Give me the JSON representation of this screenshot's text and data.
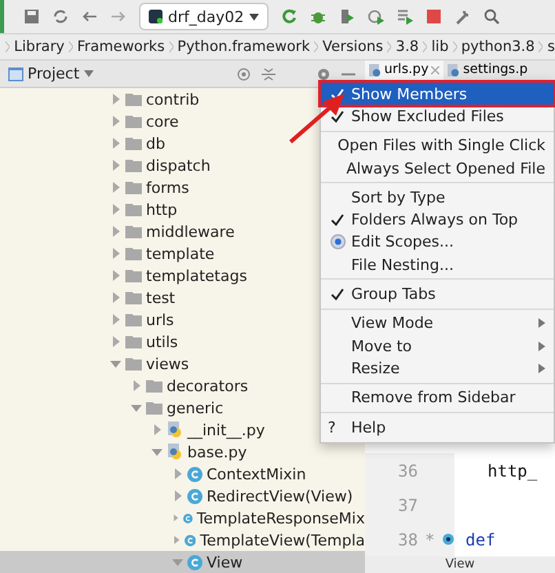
{
  "toolbar": {
    "run_config": "drf_day02"
  },
  "breadcrumbs": [
    "Library",
    "Frameworks",
    "Python.framework",
    "Versions",
    "3.8",
    "lib",
    "python3.8",
    "s"
  ],
  "project_panel": {
    "title": "Project",
    "tree": [
      {
        "label": "contrib",
        "kind": "folder",
        "expanded": false,
        "selected": false
      },
      {
        "label": "core",
        "kind": "folder",
        "expanded": false,
        "selected": false
      },
      {
        "label": "db",
        "kind": "folder",
        "expanded": false,
        "selected": false
      },
      {
        "label": "dispatch",
        "kind": "folder",
        "expanded": false,
        "selected": false
      },
      {
        "label": "forms",
        "kind": "folder",
        "expanded": false,
        "selected": false
      },
      {
        "label": "http",
        "kind": "folder",
        "expanded": false,
        "selected": false
      },
      {
        "label": "middleware",
        "kind": "folder",
        "expanded": false,
        "selected": false
      },
      {
        "label": "template",
        "kind": "folder",
        "expanded": false,
        "selected": false
      },
      {
        "label": "templatetags",
        "kind": "folder",
        "expanded": false,
        "selected": false
      },
      {
        "label": "test",
        "kind": "folder",
        "expanded": false,
        "selected": false
      },
      {
        "label": "urls",
        "kind": "folder",
        "expanded": false,
        "selected": false
      },
      {
        "label": "utils",
        "kind": "folder",
        "expanded": false,
        "selected": false
      },
      {
        "label": "views",
        "kind": "folder",
        "expanded": true,
        "selected": false,
        "children": [
          {
            "label": "decorators",
            "kind": "folder",
            "expanded": false,
            "selected": false
          },
          {
            "label": "generic",
            "kind": "folder",
            "expanded": true,
            "selected": false,
            "children": [
              {
                "label": "__init__.py",
                "kind": "python",
                "expanded": false,
                "selected": false
              },
              {
                "label": "base.py",
                "kind": "python",
                "expanded": true,
                "selected": false,
                "children": [
                  {
                    "label": "ContextMixin",
                    "kind": "class",
                    "expanded": false,
                    "selected": false
                  },
                  {
                    "label": "RedirectView(View)",
                    "kind": "class",
                    "expanded": false,
                    "selected": false
                  },
                  {
                    "label": "TemplateResponseMix",
                    "kind": "class",
                    "expanded": false,
                    "selected": false
                  },
                  {
                    "label": "TemplateView(Templa",
                    "kind": "class",
                    "expanded": false,
                    "selected": false
                  },
                  {
                    "label": "View",
                    "kind": "class",
                    "expanded": true,
                    "selected": true
                  }
                ]
              }
            ]
          }
        ]
      }
    ]
  },
  "editor": {
    "tabs": [
      {
        "label": "urls.py",
        "selected": true
      },
      {
        "label": "settings.p",
        "selected": false
      }
    ],
    "lines": [
      {
        "number": "36",
        "code": "http_"
      },
      {
        "number": "37"
      },
      {
        "number": "38",
        "code": "def",
        "marker": "*"
      }
    ],
    "footer": "View"
  },
  "menu": [
    [
      {
        "label": "Show Members",
        "kind": "check",
        "checked": true,
        "selected": true
      },
      {
        "label": "Show Excluded Files",
        "kind": "check",
        "checked": true,
        "selected": false
      }
    ],
    [
      {
        "label": "Open Files with Single Click",
        "kind": "check",
        "checked": false,
        "selected": false
      },
      {
        "label": "Always Select Opened File",
        "kind": "check",
        "checked": false,
        "selected": false
      }
    ],
    [
      {
        "label": "Sort by Type",
        "kind": "check",
        "checked": false,
        "selected": false
      },
      {
        "label": "Folders Always on Top",
        "kind": "check",
        "checked": true,
        "selected": false
      },
      {
        "label": "Edit Scopes...",
        "kind": "radio",
        "checked": true,
        "selected": false
      },
      {
        "label": "File Nesting...",
        "kind": "check",
        "checked": false,
        "selected": false
      }
    ],
    [
      {
        "label": "Group Tabs",
        "kind": "check",
        "checked": true,
        "selected": false
      }
    ],
    [
      {
        "label": "View Mode",
        "kind": "submenu",
        "selected": false
      },
      {
        "label": "Move to",
        "kind": "submenu",
        "selected": false
      },
      {
        "label": "Resize",
        "kind": "submenu",
        "selected": false
      }
    ],
    [
      {
        "label": "Remove from Sidebar",
        "kind": "check",
        "checked": false,
        "selected": false
      }
    ],
    [
      {
        "label": "Help",
        "kind": "help",
        "glyph": "?",
        "selected": false
      }
    ]
  ]
}
